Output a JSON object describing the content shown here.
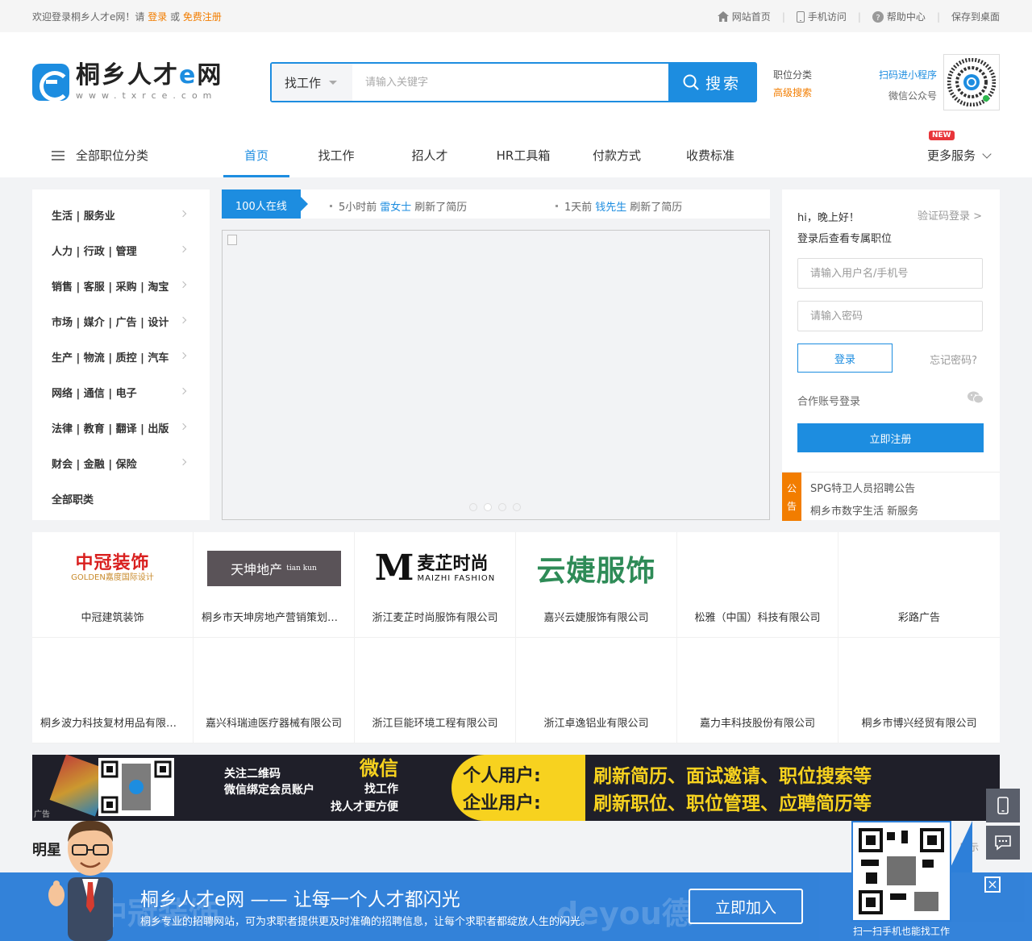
{
  "topbar": {
    "welcome_prefix": "欢迎登录桐乡人才e网！请",
    "login": "登录",
    "or": "或",
    "register": "免费注册",
    "links": [
      {
        "icon": "home-icon",
        "label": "网站首页"
      },
      {
        "icon": "mobile-icon",
        "label": "手机访问"
      },
      {
        "icon": "help-icon",
        "label": "帮助中心"
      },
      {
        "icon": "",
        "label": "保存到桌面"
      }
    ]
  },
  "logo": {
    "name_prefix": "桐乡人才",
    "name_e": "e",
    "name_suffix": "网",
    "url": "www.txrce.com"
  },
  "search": {
    "type": "找工作",
    "placeholder": "请输入关键字",
    "button": "搜索"
  },
  "header_links": {
    "category": "职位分类",
    "advanced": "高级搜索"
  },
  "mini_program": {
    "scan": "扫码进小程序",
    "wechat": "微信公众号"
  },
  "nav": {
    "all_categories": "全部职位分类",
    "items": [
      "首页",
      "找工作",
      "招人才",
      "HR工具箱",
      "付款方式",
      "收费标准"
    ],
    "new_badge": "NEW",
    "more": "更多服务"
  },
  "categories": [
    "生活 | 服务业",
    "人力 | 行政 | 管理",
    "销售 | 客服 | 采购 | 淘宝",
    "市场 | 媒介 | 广告 | 设计",
    "生产 | 物流 | 质控 | 汽车",
    "网络 | 通信 | 电子",
    "法律 | 教育 | 翻译 | 出版",
    "财会 | 金融 | 保险",
    "全部职类"
  ],
  "ticker": {
    "online": "100人在线",
    "messages": [
      {
        "time": "5小时前",
        "name": "雷女士",
        "action": "刷新了简历"
      },
      {
        "time": "1天前",
        "name": "钱先生",
        "action": "刷新了简历"
      }
    ]
  },
  "login": {
    "greeting": "hi，晚上好！",
    "code_login": "验证码登录 >",
    "subtitle": "登录后查看专属职位",
    "username_placeholder": "请输入用户名/手机号",
    "password_placeholder": "请输入密码",
    "login_button": "登录",
    "forgot": "忘记密码?",
    "partner_login": "合作账号登录",
    "register_button": "立即注册"
  },
  "notice": {
    "tag1": "公",
    "tag2": "告",
    "items": [
      "SPG特卫人员招聘公告",
      "桐乡市数字生活 新服务"
    ]
  },
  "companies": [
    {
      "name": "中冠建筑装饰",
      "logo_main": "中冠装饰",
      "logo_sub": "GOLDEN嘉度国际设计"
    },
    {
      "name": "桐乡市天坤房地产营销策划有限公司",
      "logo_main": "天坤地产",
      "logo_sub": "tian kun"
    },
    {
      "name": "浙江麦芷时尚服饰有限公司",
      "logo_main": "麦芷时尚",
      "logo_sub": "MAIZHI FASHION"
    },
    {
      "name": "嘉兴云婕服饰有限公司",
      "logo_main": "云婕服饰",
      "logo_sub": ""
    },
    {
      "name": "松雅（中国）科技有限公司",
      "logo_main": "",
      "logo_sub": ""
    },
    {
      "name": "彩路广告",
      "logo_main": "",
      "logo_sub": ""
    },
    {
      "name": "桐乡波力科技复材用品有限公司",
      "logo_main": "",
      "logo_sub": ""
    },
    {
      "name": "嘉兴科瑞迪医疗器械有限公司",
      "logo_main": "",
      "logo_sub": ""
    },
    {
      "name": "浙江巨能环境工程有限公司",
      "logo_main": "",
      "logo_sub": ""
    },
    {
      "name": "浙江卓逸铝业有限公司",
      "logo_main": "",
      "logo_sub": ""
    },
    {
      "name": "嘉力丰科技股份有限公司",
      "logo_main": "",
      "logo_sub": ""
    },
    {
      "name": "桐乡市博兴经贸有限公司",
      "logo_main": "",
      "logo_sub": ""
    }
  ],
  "wide_ad": {
    "line1": "关注二维码",
    "line2": "微信绑定会员账户",
    "big": "微信",
    "line3": "找工作",
    "line4": "找人才更方便",
    "personal": "个人用户:",
    "enterprise": "企业用户:",
    "personal_desc": "刷新简历、面试邀请、职位搜索等",
    "enterprise_desc": "刷新职位、职位管理、应聘简历等",
    "ad_label": "广告"
  },
  "famous": {
    "title": "明星",
    "right": "展示"
  },
  "bottom_bar": {
    "title": "桐乡人才e网 —— 让每一个人才都闪光",
    "desc": "桐乡专业的招聘网站，可为求职者提供更及时准确的招聘信息，让每个求职者都绽放人生的闪光。",
    "join": "立即加入",
    "close": "×",
    "qr_caption": "扫一扫手机也能找工作",
    "ghost1": "中冠装饰",
    "ghost2": "deyou德"
  },
  "colors": {
    "primary": "#1d8de0",
    "accent": "#f27d00",
    "bar": "#2d7fd9"
  }
}
